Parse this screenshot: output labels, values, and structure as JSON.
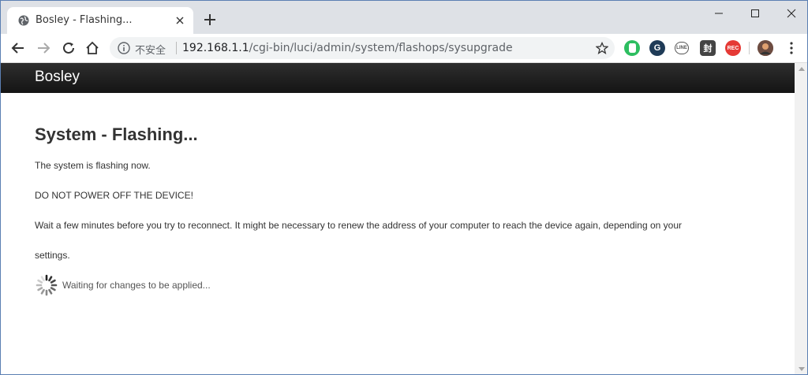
{
  "browser": {
    "tab_title": "Bosley - Flashing...",
    "address": {
      "security_label": "不安全",
      "host": "192.168.1.1",
      "path": "/cgi-bin/luci/admin/system/flashops/sysupgrade"
    },
    "extensions": [
      {
        "name": "evernote-icon",
        "color": "#2dbe60"
      },
      {
        "name": "grammar-icon",
        "color": "#1f3b57"
      },
      {
        "name": "line-icon",
        "color": "#555555"
      },
      {
        "name": "encode-icon",
        "label": "封",
        "color": "#444444"
      },
      {
        "name": "record-icon",
        "label": "REC",
        "color": "#e53935"
      }
    ]
  },
  "page": {
    "brand": "Bosley",
    "title": "System - Flashing...",
    "paragraphs": [
      "The system is flashing now.",
      "DO NOT POWER OFF THE DEVICE!",
      "Wait a few minutes before you try to reconnect. It might be necessary to renew the address of your computer to reach the device again, depending on your",
      "settings."
    ],
    "waiting_text": "Waiting for changes to be applied..."
  }
}
